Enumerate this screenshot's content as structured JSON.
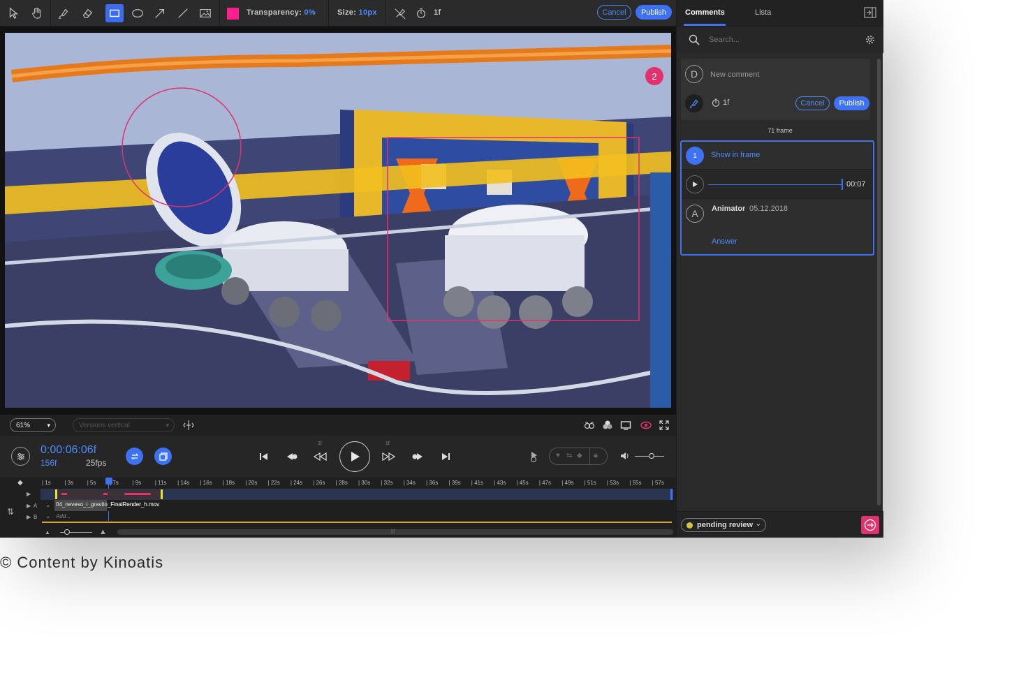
{
  "toolbar": {
    "transparency_label": "Transparency:",
    "transparency_value": "0%",
    "size_label": "Size:",
    "size_value": "10px",
    "frame_value": "1f",
    "cancel_label": "Cancel",
    "publish_label": "Publish",
    "color": "#ff1f8e",
    "icons": [
      "pointer-icon",
      "hand-icon",
      "brush-icon",
      "eraser-icon",
      "rectangle-icon",
      "ellipse-icon",
      "arrow-icon",
      "line-icon",
      "image-icon",
      "color-swatch",
      "brush-off-icon",
      "timer-icon"
    ]
  },
  "viewer": {
    "frame_badge": "2"
  },
  "viewer_bar": {
    "zoom": "61%",
    "versions_placeholder": "Versions vertical",
    "icons": [
      "compare-icon",
      "channels-icon",
      "monitor-icon",
      "eye-icon",
      "fullscreen-icon"
    ]
  },
  "transport": {
    "timecode": "0:00:06:06f",
    "frame_count": "156f",
    "fps": "25fps",
    "step_back_label": "1f",
    "step_forward_label": "1f"
  },
  "timeline": {
    "ticks": [
      "1s",
      "3s",
      "5s",
      "7s",
      "9s",
      "11s",
      "14s",
      "16s",
      "18s",
      "20s",
      "22s",
      "24s",
      "26s",
      "28s",
      "30s",
      "32s",
      "34s",
      "36s",
      "39s",
      "41s",
      "43s",
      "45s",
      "47s",
      "49s",
      "51s",
      "53s",
      "55s",
      "57s"
    ],
    "track_a_label": "A",
    "track_b_label": "B",
    "clip_name": "04_neveso_i_gravito_FinalRender_h.mov",
    "add_label": "Add..."
  },
  "panel": {
    "tab_comments": "Comments",
    "tab_list": "Lista",
    "search_placeholder": "Search...",
    "new_comment": {
      "avatar": "D",
      "placeholder": "New comment",
      "frame": "1f",
      "cancel_label": "Cancel",
      "publish_label": "Publish"
    },
    "frame_header": "71 frame",
    "comment": {
      "number": "1",
      "show_in_frame": "Show in frame",
      "duration": "00:07",
      "avatar": "A",
      "author": "Animator",
      "date": "05.12.2018",
      "answer_label": "Answer"
    },
    "status": "pending review"
  },
  "credit": "© Content by Kinoatis"
}
